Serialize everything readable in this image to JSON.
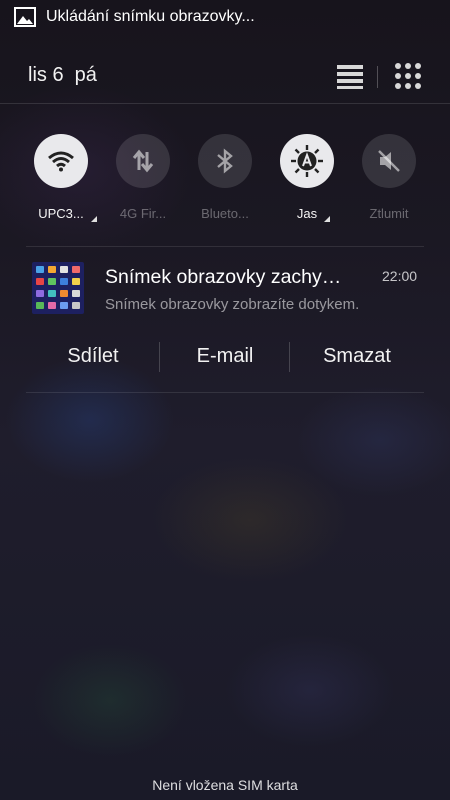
{
  "status_bar": {
    "icon": "image-icon",
    "text": "Ukládání snímku obrazovky..."
  },
  "header": {
    "date": "lis 6  pá",
    "list_icon": "list-lines-icon",
    "grid_icon": "grid-dots-icon"
  },
  "quick_settings": [
    {
      "label": "UPC3...",
      "icon": "wifi-icon",
      "state": "on"
    },
    {
      "label": "4G Fir...",
      "icon": "data-arrows-icon",
      "state": "off"
    },
    {
      "label": "Blueto...",
      "icon": "bluetooth-icon",
      "state": "off"
    },
    {
      "label": "Jas",
      "icon": "brightness-auto-icon",
      "state": "on"
    },
    {
      "label": "Ztlumit",
      "icon": "mute-icon",
      "state": "off"
    }
  ],
  "notification": {
    "title": "Snímek obrazovky zachy…",
    "time": "22:00",
    "subtitle": "Snímek obrazovky zobrazíte dotykem.",
    "actions": [
      "Sdílet",
      "E-mail",
      "Smazat"
    ]
  },
  "footer": {
    "sim_status": "Není vložena SIM karta"
  },
  "colors": {
    "toggle_on": "#e9e9ec",
    "toggle_off": "#3a3842",
    "background": "#1b1823"
  }
}
